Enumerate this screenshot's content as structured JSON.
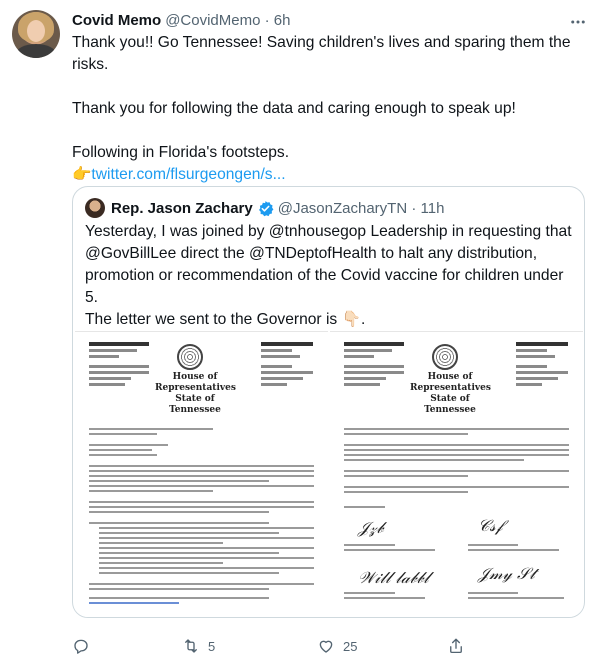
{
  "tweet": {
    "name": "Covid Memo",
    "handle": "@CovidMemo · 6h",
    "lines": [
      "Thank you!! Go Tennessee! Saving children's lives and sparing them the",
      "risks.",
      "Thank you for following the data and caring enough to speak up!",
      "Following in Florida's footsteps."
    ],
    "link_prefix": "👉",
    "link_text": "twitter.com/flsurgeongen/s..."
  },
  "quote": {
    "name": "Rep. Jason Zachary",
    "handle": "@JasonZacharyTN · 11h",
    "lines": [
      "Yesterday, I was joined by @tnhousegop Leadership in requesting that",
      "@GovBillLee direct the @TNDeptofHealth to halt any distribution,",
      "promotion or recommendation of the Covid vaccine for children under",
      "5.",
      "The letter we sent to the Governor is 👇🏻."
    ]
  },
  "letter": {
    "house_title_1": "House of Representatives",
    "house_title_2": "State of Tennessee"
  },
  "actions": {
    "reply_count": "",
    "retweet_count": "5",
    "like_count": "25"
  },
  "colors": {
    "link": "#1d9bf0",
    "secondary": "#536471",
    "border": "#cfd9de",
    "verified": "#1d9bf0"
  }
}
